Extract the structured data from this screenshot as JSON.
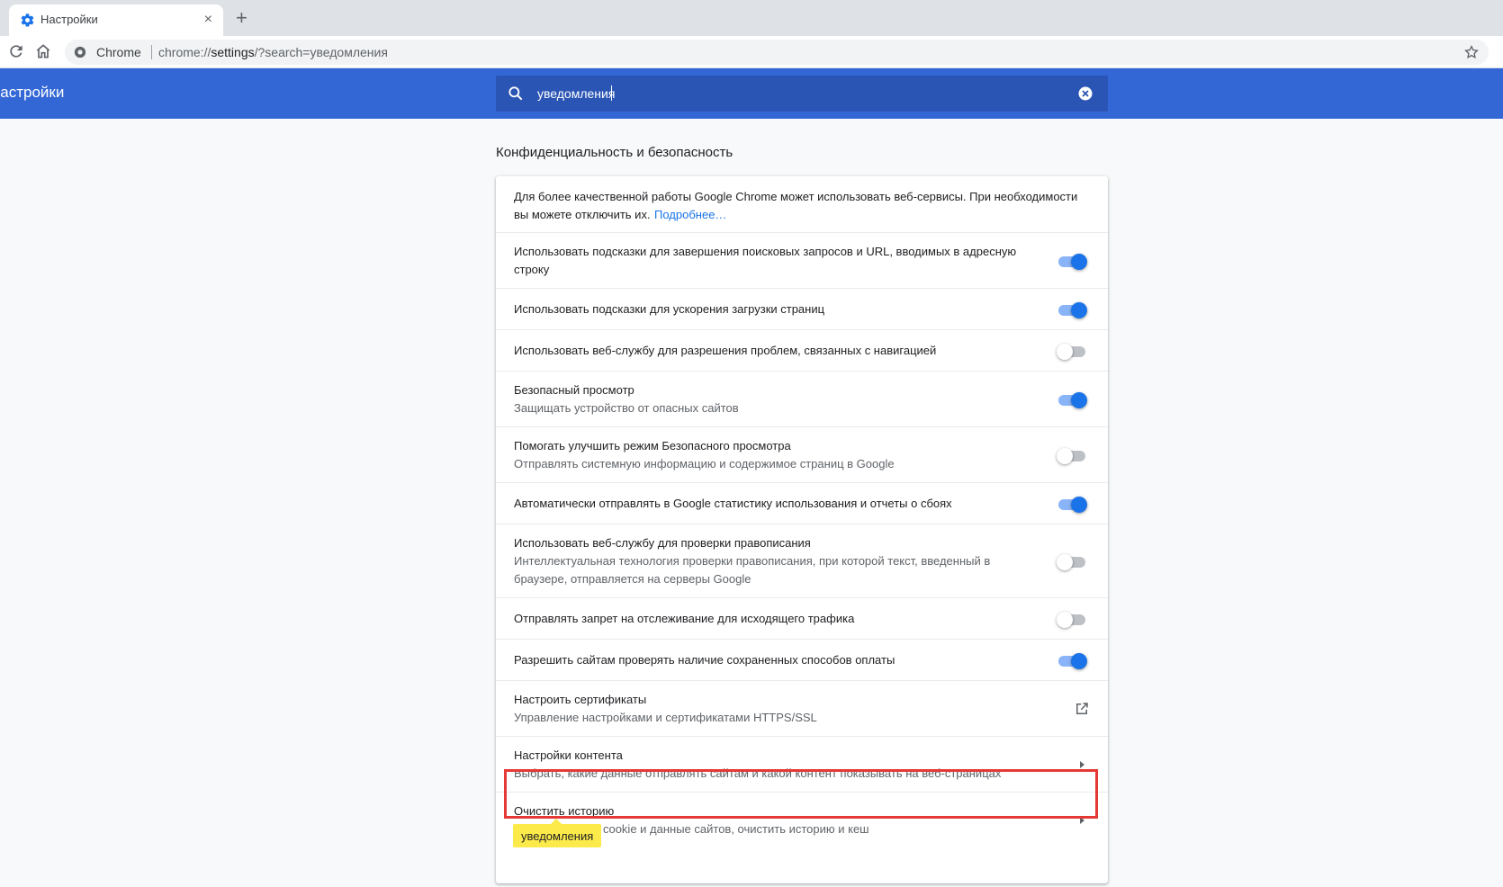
{
  "tab": {
    "title": "Настройки",
    "close": "×",
    "new_tab": "+"
  },
  "toolbar": {
    "omnibox_label": "Chrome",
    "url_scheme": "chrome://",
    "url_host": "settings",
    "url_rest": "/?search=уведомления"
  },
  "header": {
    "title": "Настройки",
    "search_value": "уведомления"
  },
  "section_title": "Конфиденциальность и безопасность",
  "rows": [
    {
      "primary": "Для более качественной работы Google Chrome может использовать веб-сервисы. При необходимости вы можете отключить их.",
      "link": "Подробнее…"
    },
    {
      "primary": "Использовать подсказки для завершения поисковых запросов и URL, вводимых в адресную строку",
      "toggle": "on"
    },
    {
      "primary": "Использовать подсказки для ускорения загрузки страниц",
      "toggle": "on"
    },
    {
      "primary": "Использовать веб-службу для разрешения проблем, связанных с навигацией",
      "toggle": "off"
    },
    {
      "primary": "Безопасный просмотр",
      "secondary": "Защищать устройство от опасных сайтов",
      "toggle": "on"
    },
    {
      "primary": "Помогать улучшить режим Безопасного просмотра",
      "secondary": "Отправлять системную информацию и содержимое страниц в Google",
      "toggle": "off"
    },
    {
      "primary": "Автоматически отправлять в Google статистику использования и отчеты о сбоях",
      "toggle": "on"
    },
    {
      "primary": "Использовать веб-службу для проверки правописания",
      "secondary": "Интеллектуальная технология проверки правописания, при которой текст, введенный в браузере, отправляется на серверы Google",
      "toggle": "off"
    },
    {
      "primary": "Отправлять запрет на отслеживание для исходящего трафика",
      "toggle": "off"
    },
    {
      "primary": "Разрешить сайтам проверять наличие сохраненных способов оплаты",
      "toggle": "on"
    },
    {
      "primary": "Настроить сертификаты",
      "secondary": "Управление настройками и сертификатами HTTPS/SSL",
      "icon": "open-in-new-icon"
    },
    {
      "primary": "Настройки контента",
      "secondary": "Выбрать, какие данные отправлять сайтам и какой контент показывать на веб-страницах",
      "icon": "arrow-right-icon"
    },
    {
      "primary": "Очистить историю",
      "secondary": "Удалить файлы cookie и данные сайтов, очистить историю и кеш",
      "icon": "arrow-right-icon"
    }
  ],
  "search_bubble": "уведомления",
  "colors": {
    "header": "#3367d6",
    "accent": "#1a73e8",
    "highlight": "#e53935",
    "bubble": "#fcea4a"
  }
}
